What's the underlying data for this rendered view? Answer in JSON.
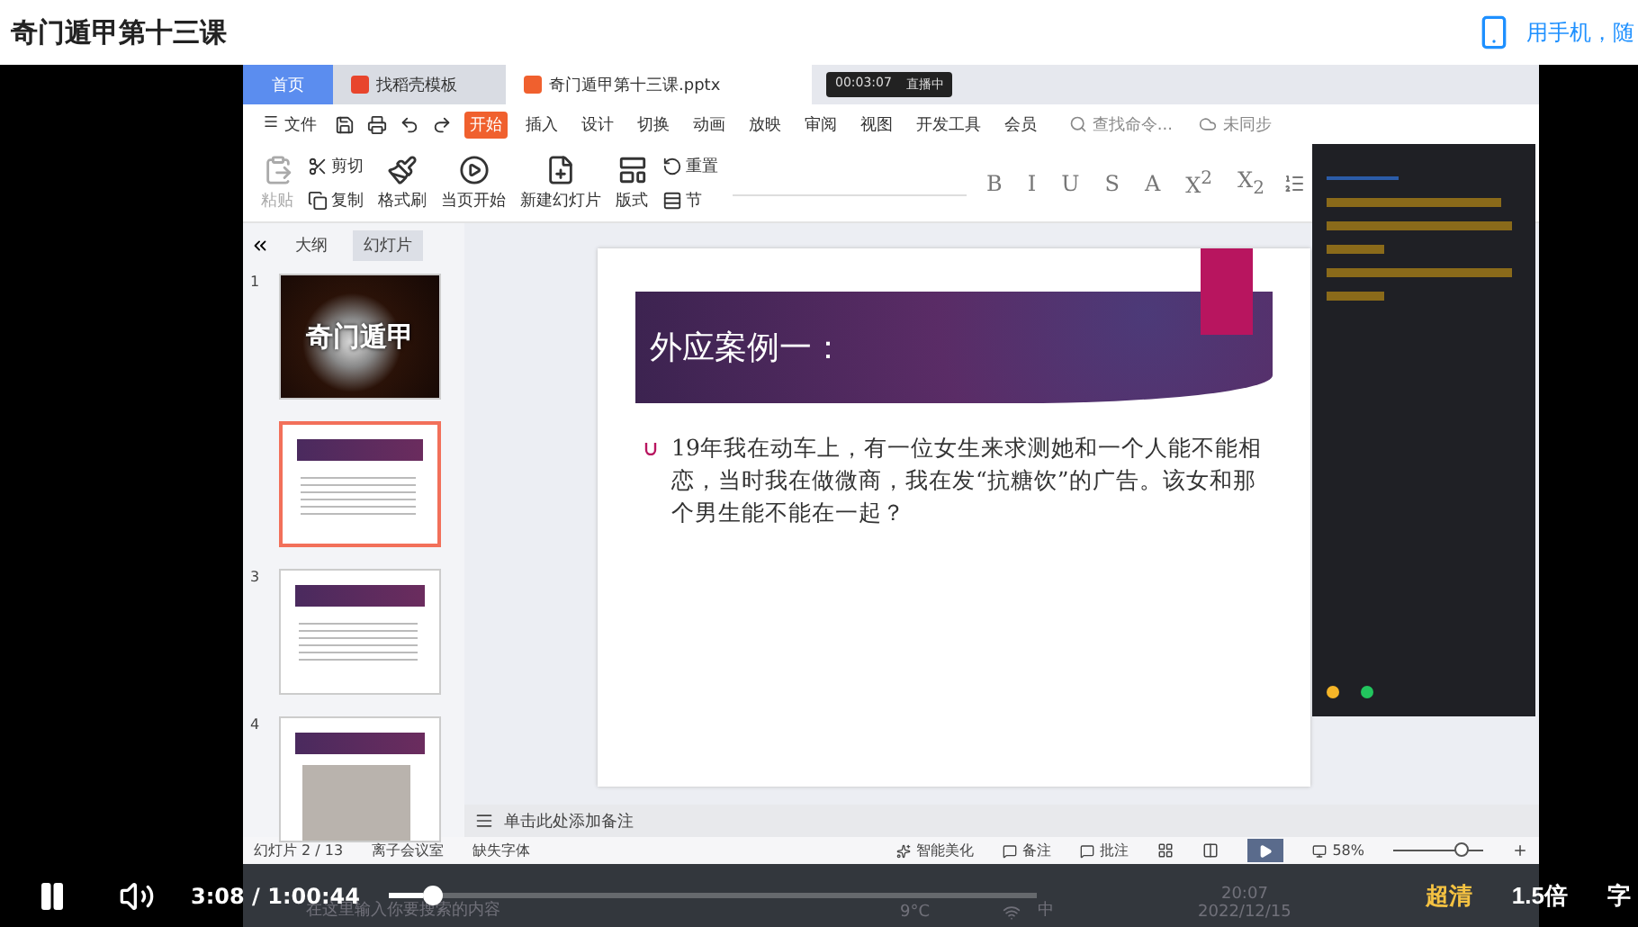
{
  "page_title": "奇门遁甲第十三课",
  "mobile_link": "用手机，随",
  "wps": {
    "tabs": [
      {
        "label": "首页",
        "kind": "home",
        "selected": false
      },
      {
        "label": "找稻壳模板",
        "kind": "template",
        "selected": false
      },
      {
        "label": "奇门遁甲第十三课.pptx",
        "kind": "document",
        "selected": true
      }
    ],
    "recording": {
      "time": "00:03:07",
      "status": "直播中"
    },
    "file_menu": "文件",
    "menu": [
      {
        "label": "开始",
        "selected": true
      },
      {
        "label": "插入",
        "selected": false
      },
      {
        "label": "设计",
        "selected": false
      },
      {
        "label": "切换",
        "selected": false
      },
      {
        "label": "动画",
        "selected": false
      },
      {
        "label": "放映",
        "selected": false
      },
      {
        "label": "审阅",
        "selected": false
      },
      {
        "label": "视图",
        "selected": false
      },
      {
        "label": "开发工具",
        "selected": false
      },
      {
        "label": "会员",
        "selected": false
      }
    ],
    "search_placeholder": "查找命令...",
    "sync": "未同步",
    "ribbon": [
      {
        "label": "粘贴",
        "kind": "paste",
        "disabled": true
      },
      {
        "label": "剪切",
        "kind": "cut",
        "disabled": false
      },
      {
        "label": "复制",
        "kind": "copy",
        "disabled": false
      },
      {
        "label": "格式刷",
        "kind": "brush",
        "disabled": false
      },
      {
        "label": "当页开始",
        "kind": "play",
        "disabled": false
      },
      {
        "label": "新建幻灯片",
        "kind": "new",
        "disabled": false
      },
      {
        "label": "版式",
        "kind": "layout",
        "disabled": false
      },
      {
        "label": "重置",
        "kind": "reset",
        "disabled": false
      },
      {
        "label": "节",
        "kind": "section",
        "disabled": false
      }
    ],
    "format_buttons": [
      "B",
      "I",
      "U",
      "S",
      "A",
      "X$^{2}$",
      "X$_{2}$"
    ],
    "outline_tabs": [
      {
        "label": "大纲",
        "selected": false
      },
      {
        "label": "幻灯片",
        "selected": true
      }
    ],
    "slides": [
      {
        "number": "1",
        "kind": "cover",
        "selected": false,
        "title": "奇门遁甲"
      },
      {
        "kind": "content",
        "selected": true
      },
      {
        "number": "3",
        "kind": "content",
        "selected": false
      },
      {
        "number": "4",
        "kind": "photo",
        "selected": false
      }
    ],
    "slide": {
      "title": "外应案例一：",
      "body": "19年我在动车上，有一位女生来求测她和一个人能不能相恋，当时我在做微商，我在发“抗糖饮”的广告。该女和那个男生能不能在一起？"
    },
    "notes_placeholder": "单击此处添加备注",
    "status": {
      "slide_counter": "幻灯片 2 / 13",
      "left_items": [
        "离子会议室",
        "缺失字体"
      ],
      "right_items": [
        "智能美化",
        "备注",
        "批注"
      ],
      "zoom": "58%",
      "level": 0.75
    },
    "chat": {
      "reactions": [
        {
          "color": "#f5b528"
        },
        {
          "color": "#22c55e"
        }
      ]
    },
    "taskbar": {
      "search_placeholder": "在这里输入你要搜索的内容",
      "weather": "9°C",
      "ime": "中",
      "time": "20:07",
      "date": "2022/12/15"
    }
  },
  "player": {
    "playing": true,
    "current": "3:08",
    "separator": "/",
    "duration": "1:00:44",
    "level": 0.052,
    "quality": "超清",
    "speed": "1.5倍",
    "subtitle": "字"
  }
}
